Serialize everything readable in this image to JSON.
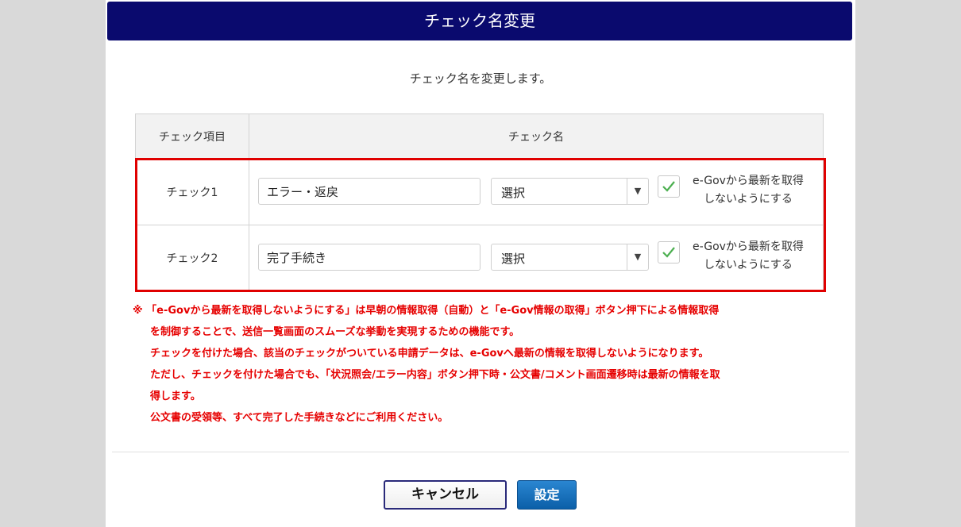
{
  "dialog": {
    "title": "チェック名変更",
    "subtitle": "チェック名を変更します。"
  },
  "table": {
    "headers": [
      "チェック項目",
      "チェック名"
    ],
    "rows": [
      {
        "label": "チェック1",
        "name_value": "エラー・返戻",
        "select_value": "選択",
        "checked": true,
        "checkbox_label_line1": "e-Govから最新を取得",
        "checkbox_label_line2": "しないようにする"
      },
      {
        "label": "チェック2",
        "name_value": "完了手続き",
        "select_value": "選択",
        "checked": true,
        "checkbox_label_line1": "e-Govから最新を取得",
        "checkbox_label_line2": "しないようにする"
      }
    ]
  },
  "notes": [
    "※ 「e-Govから最新を取得しないようにする」は早朝の情報取得（自動）と「e-Gov情報の取得」ボタン押下による情報取得",
    "を制御することで、送信一覧画面のスムーズな挙動を実現するための機能です。",
    "チェックを付けた場合、該当のチェックがついている申請データは、e-Govへ最新の情報を取得しないようになります。",
    "ただし、チェックを付けた場合でも、「状況照会/エラー内容」ボタン押下時・公文書/コメント画面遷移時は最新の情報を取",
    "得します。",
    "公文書の受領等、すべて完了した手続きなどにご利用ください。"
  ],
  "buttons": {
    "cancel_label": "キャンセル",
    "ok_label": "設定"
  },
  "colors": {
    "titlebar": "#0a0a6e",
    "highlight": "#e00000",
    "note_text": "#e60000",
    "ok_button": "#0b5fa8",
    "check_mark": "#4caf50"
  }
}
